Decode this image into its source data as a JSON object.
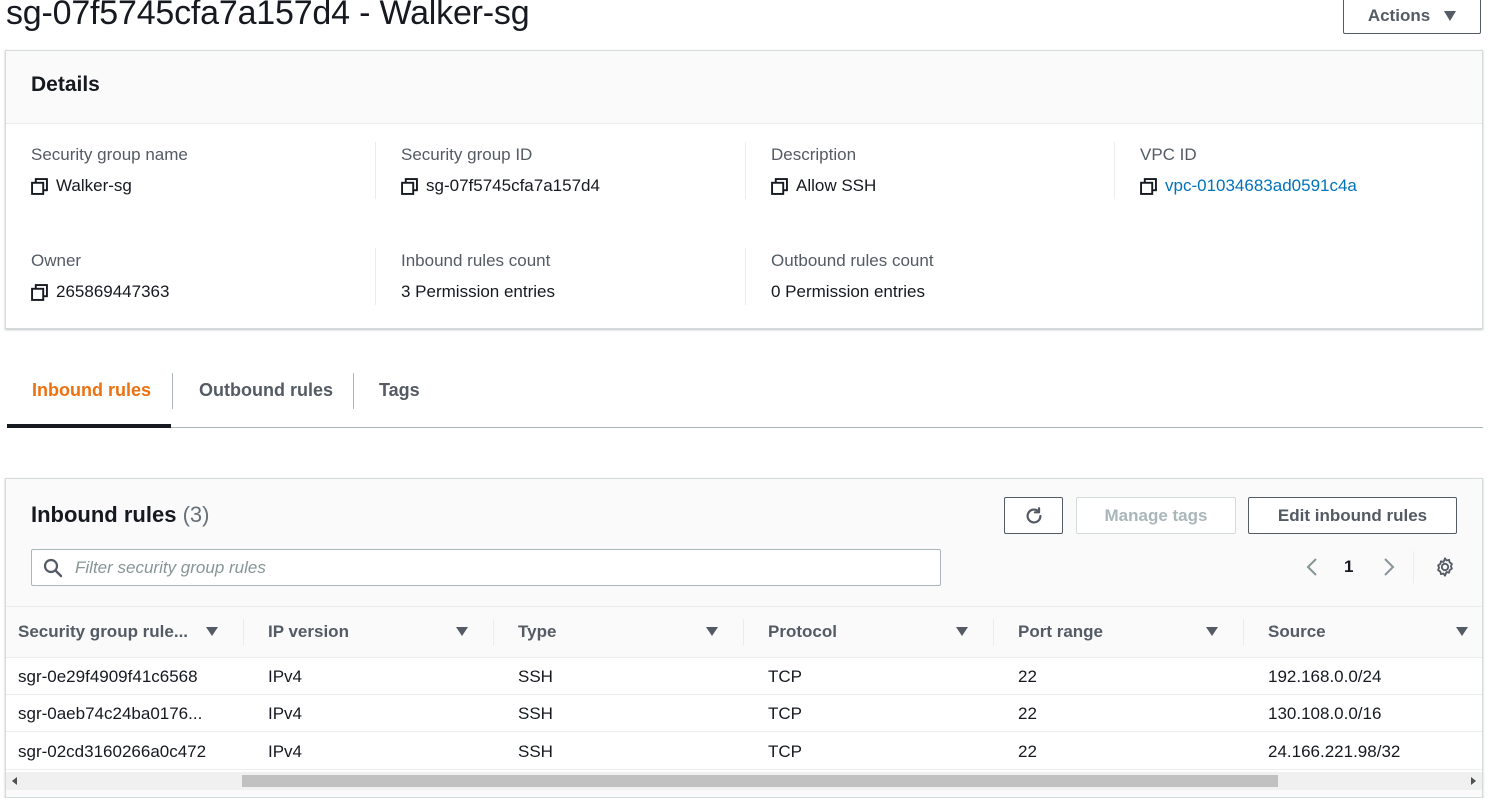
{
  "page": {
    "title": "sg-07f5745cfa7a157d4 - Walker-sg",
    "actions_label": "Actions"
  },
  "details": {
    "title": "Details",
    "fields": [
      {
        "label": "Security group name",
        "value": "Walker-sg"
      },
      {
        "label": "Security group ID",
        "value": "sg-07f5745cfa7a157d4"
      },
      {
        "label": "Description",
        "value": "Allow SSH"
      },
      {
        "label": "VPC ID",
        "value": "vpc-01034683ad0591c4a"
      },
      {
        "label": "Owner",
        "value": "265869447363"
      },
      {
        "label": "Inbound rules count",
        "value": "3 Permission entries"
      },
      {
        "label": "Outbound rules count",
        "value": "0 Permission entries"
      }
    ]
  },
  "tabs": [
    {
      "label": "Inbound rules",
      "active": true
    },
    {
      "label": "Outbound rules",
      "active": false
    },
    {
      "label": "Tags",
      "active": false
    }
  ],
  "inbound": {
    "title": "Inbound rules",
    "count": "(3)",
    "manage_tags_label": "Manage tags",
    "edit_label": "Edit inbound rules",
    "search_placeholder": "Filter security group rules",
    "page_number": "1",
    "columns": [
      "Security group rule...",
      "IP version",
      "Type",
      "Protocol",
      "Port range",
      "Source"
    ],
    "rows": [
      [
        "sgr-0e29f4909f41c6568",
        "IPv4",
        "SSH",
        "TCP",
        "22",
        "192.168.0.0/24"
      ],
      [
        "sgr-0aeb74c24ba0176...",
        "IPv4",
        "SSH",
        "TCP",
        "22",
        "130.108.0.0/16"
      ],
      [
        "sgr-02cd3160266a0c472",
        "IPv4",
        "SSH",
        "TCP",
        "22",
        "24.166.221.98/32"
      ]
    ]
  },
  "colors": {
    "accent": "#ec7211",
    "link": "#0073bb",
    "text": "#16191f",
    "muted": "#545b64"
  }
}
